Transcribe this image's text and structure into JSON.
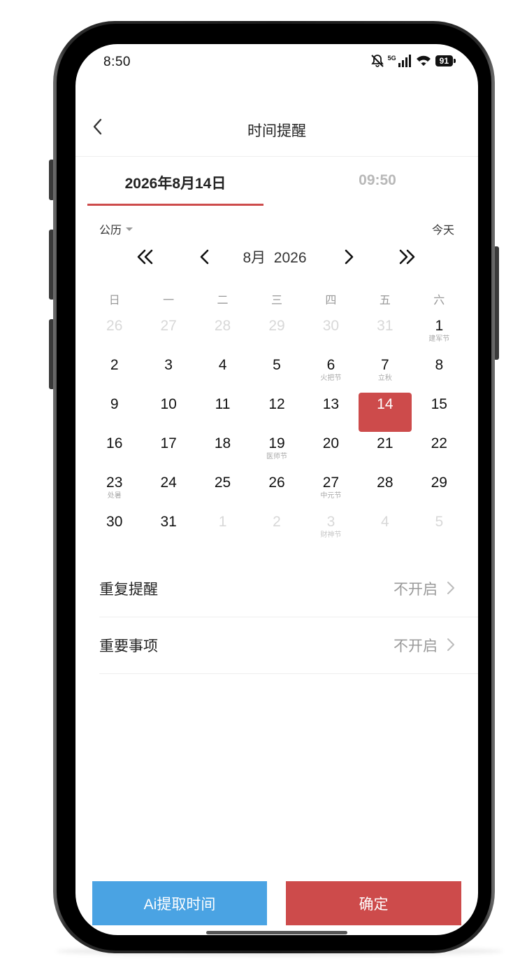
{
  "status_bar": {
    "time": "8:50",
    "network": "5G",
    "battery": "91"
  },
  "nav": {
    "title": "时间提醒"
  },
  "tabs": {
    "date": "2026年8月14日",
    "time": "09:50"
  },
  "calendar": {
    "mode_label": "公历",
    "today_label": "今天",
    "month_label": "8月  2026",
    "weekdays": [
      "日",
      "一",
      "二",
      "三",
      "四",
      "五",
      "六"
    ],
    "days": [
      {
        "num": "26",
        "fest": "",
        "dim": true
      },
      {
        "num": "27",
        "fest": "",
        "dim": true
      },
      {
        "num": "28",
        "fest": "",
        "dim": true
      },
      {
        "num": "29",
        "fest": "",
        "dim": true
      },
      {
        "num": "30",
        "fest": "",
        "dim": true
      },
      {
        "num": "31",
        "fest": "",
        "dim": true
      },
      {
        "num": "1",
        "fest": "建军节",
        "dim": false
      },
      {
        "num": "2",
        "fest": "",
        "dim": false
      },
      {
        "num": "3",
        "fest": "",
        "dim": false
      },
      {
        "num": "4",
        "fest": "",
        "dim": false
      },
      {
        "num": "5",
        "fest": "",
        "dim": false
      },
      {
        "num": "6",
        "fest": "火把节",
        "dim": false
      },
      {
        "num": "7",
        "fest": "立秋",
        "dim": false
      },
      {
        "num": "8",
        "fest": "",
        "dim": false
      },
      {
        "num": "9",
        "fest": "",
        "dim": false
      },
      {
        "num": "10",
        "fest": "",
        "dim": false
      },
      {
        "num": "11",
        "fest": "",
        "dim": false
      },
      {
        "num": "12",
        "fest": "",
        "dim": false
      },
      {
        "num": "13",
        "fest": "",
        "dim": false
      },
      {
        "num": "14",
        "fest": "",
        "dim": false,
        "selected": true
      },
      {
        "num": "15",
        "fest": "",
        "dim": false
      },
      {
        "num": "16",
        "fest": "",
        "dim": false
      },
      {
        "num": "17",
        "fest": "",
        "dim": false
      },
      {
        "num": "18",
        "fest": "",
        "dim": false
      },
      {
        "num": "19",
        "fest": "医师节",
        "dim": false
      },
      {
        "num": "20",
        "fest": "",
        "dim": false
      },
      {
        "num": "21",
        "fest": "",
        "dim": false
      },
      {
        "num": "22",
        "fest": "",
        "dim": false
      },
      {
        "num": "23",
        "fest": "处暑",
        "dim": false
      },
      {
        "num": "24",
        "fest": "",
        "dim": false
      },
      {
        "num": "25",
        "fest": "",
        "dim": false
      },
      {
        "num": "26",
        "fest": "",
        "dim": false
      },
      {
        "num": "27",
        "fest": "中元节",
        "dim": false
      },
      {
        "num": "28",
        "fest": "",
        "dim": false
      },
      {
        "num": "29",
        "fest": "",
        "dim": false
      },
      {
        "num": "30",
        "fest": "",
        "dim": false
      },
      {
        "num": "31",
        "fest": "",
        "dim": false
      },
      {
        "num": "1",
        "fest": "",
        "dim": true
      },
      {
        "num": "2",
        "fest": "",
        "dim": true
      },
      {
        "num": "3",
        "fest": "财神节",
        "dim": true
      },
      {
        "num": "4",
        "fest": "",
        "dim": true
      },
      {
        "num": "5",
        "fest": "",
        "dim": true
      }
    ]
  },
  "settings": [
    {
      "label": "重复提醒",
      "value": "不开启"
    },
    {
      "label": "重要事项",
      "value": "不开启"
    }
  ],
  "buttons": {
    "ai": "Ai提取时间",
    "confirm": "确定"
  },
  "colors": {
    "accent": "#cd4b4b",
    "ai_button": "#4aa3e3"
  }
}
